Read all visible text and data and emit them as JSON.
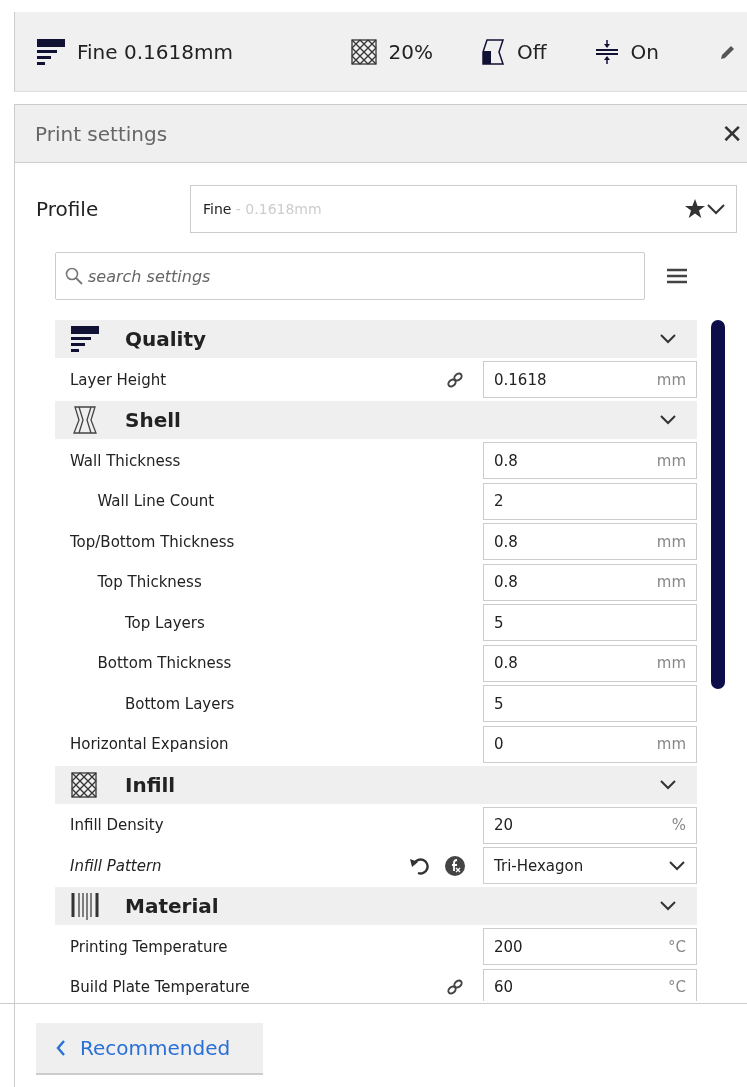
{
  "top_bar": {
    "items": [
      {
        "kind": "quality",
        "label": "Fine 0.1618mm"
      },
      {
        "kind": "infill",
        "label": "20%"
      },
      {
        "kind": "support",
        "label": "Off"
      },
      {
        "kind": "adhesion",
        "label": "On"
      },
      {
        "kind": "edit"
      }
    ]
  },
  "panel": {
    "title": "Print settings",
    "close": "✕",
    "profile": {
      "label": "Profile",
      "name": "Fine",
      "detail": " - 0.1618mm"
    },
    "search": {
      "placeholder": "search settings"
    },
    "categories": [
      {
        "kind": "quality",
        "name": "Quality",
        "expanded": true,
        "settings": [
          {
            "label": "Layer Height",
            "linked": true,
            "kind": "text",
            "value": "0.1618",
            "unit": "mm"
          }
        ]
      },
      {
        "kind": "shell",
        "name": "Shell",
        "expanded": true,
        "settings": [
          {
            "label": "Wall Thickness",
            "kind": "text",
            "value": "0.8",
            "unit": "mm",
            "children": [
              {
                "label": "Wall Line Count",
                "kind": "text",
                "value": "2"
              }
            ]
          },
          {
            "label": "Top/Bottom Thickness",
            "kind": "text",
            "value": "0.8",
            "unit": "mm",
            "children": [
              {
                "label": "Top Thickness",
                "kind": "text",
                "value": "0.8",
                "unit": "mm",
                "children": [
                  {
                    "label": "Top Layers",
                    "kind": "text",
                    "value": "5"
                  }
                ]
              },
              {
                "label": "Bottom Thickness",
                "kind": "text",
                "value": "0.8",
                "unit": "mm",
                "children": [
                  {
                    "label": "Bottom Layers",
                    "kind": "text",
                    "value": "5"
                  }
                ]
              }
            ]
          },
          {
            "label": "Horizontal Expansion",
            "kind": "text",
            "value": "0",
            "unit": "mm"
          }
        ]
      },
      {
        "kind": "infill",
        "name": "Infill",
        "expanded": true,
        "settings": [
          {
            "label": "Infill Density",
            "kind": "text",
            "value": "20",
            "unit": "%"
          },
          {
            "label": "Infill Pattern",
            "overridden": true,
            "resettable": true,
            "formula": true,
            "kind": "dropdown",
            "value": "Tri-Hexagon"
          }
        ]
      },
      {
        "kind": "material",
        "name": "Material",
        "expanded": true,
        "settings": [
          {
            "label": "Printing Temperature",
            "kind": "text",
            "value": "200",
            "unit": "°C"
          },
          {
            "label": "Build Plate Temperature",
            "linked": true,
            "kind": "text",
            "value": "60",
            "unit": "°C"
          }
        ]
      }
    ],
    "footer_button": "Recommended"
  }
}
